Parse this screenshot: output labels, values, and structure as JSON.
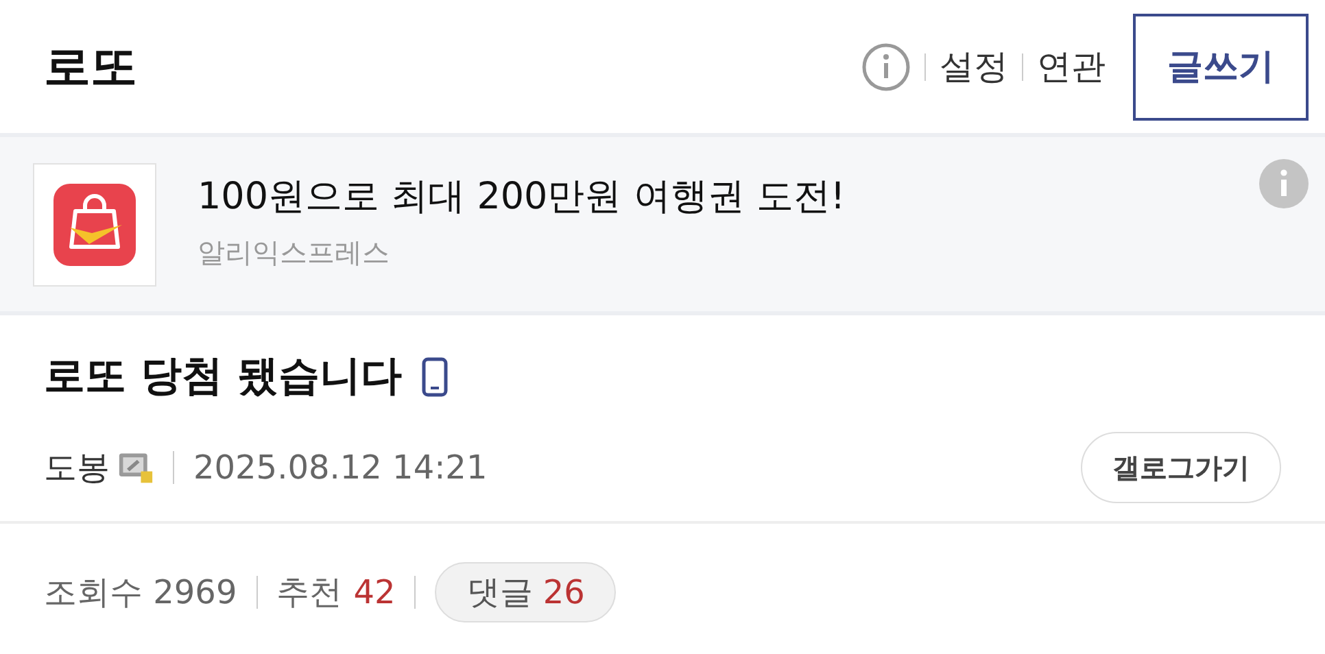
{
  "header": {
    "title": "로또",
    "links": [
      "설정",
      "연관"
    ],
    "write_button": "글쓰기"
  },
  "ad": {
    "headline": "100원으로 최대 200만원 여행권 도전!",
    "advertiser": "알리익스프레스"
  },
  "post": {
    "title": "로또 당첨 됐습니다",
    "author": "도봉",
    "date": "2025.08.12 14:21",
    "gallery_button": "갤로그가기"
  },
  "stats": {
    "views_label": "조회수",
    "views": "2969",
    "recommend_label": "추천",
    "recommend": "42",
    "comments_label": "댓글",
    "comments": "26"
  }
}
